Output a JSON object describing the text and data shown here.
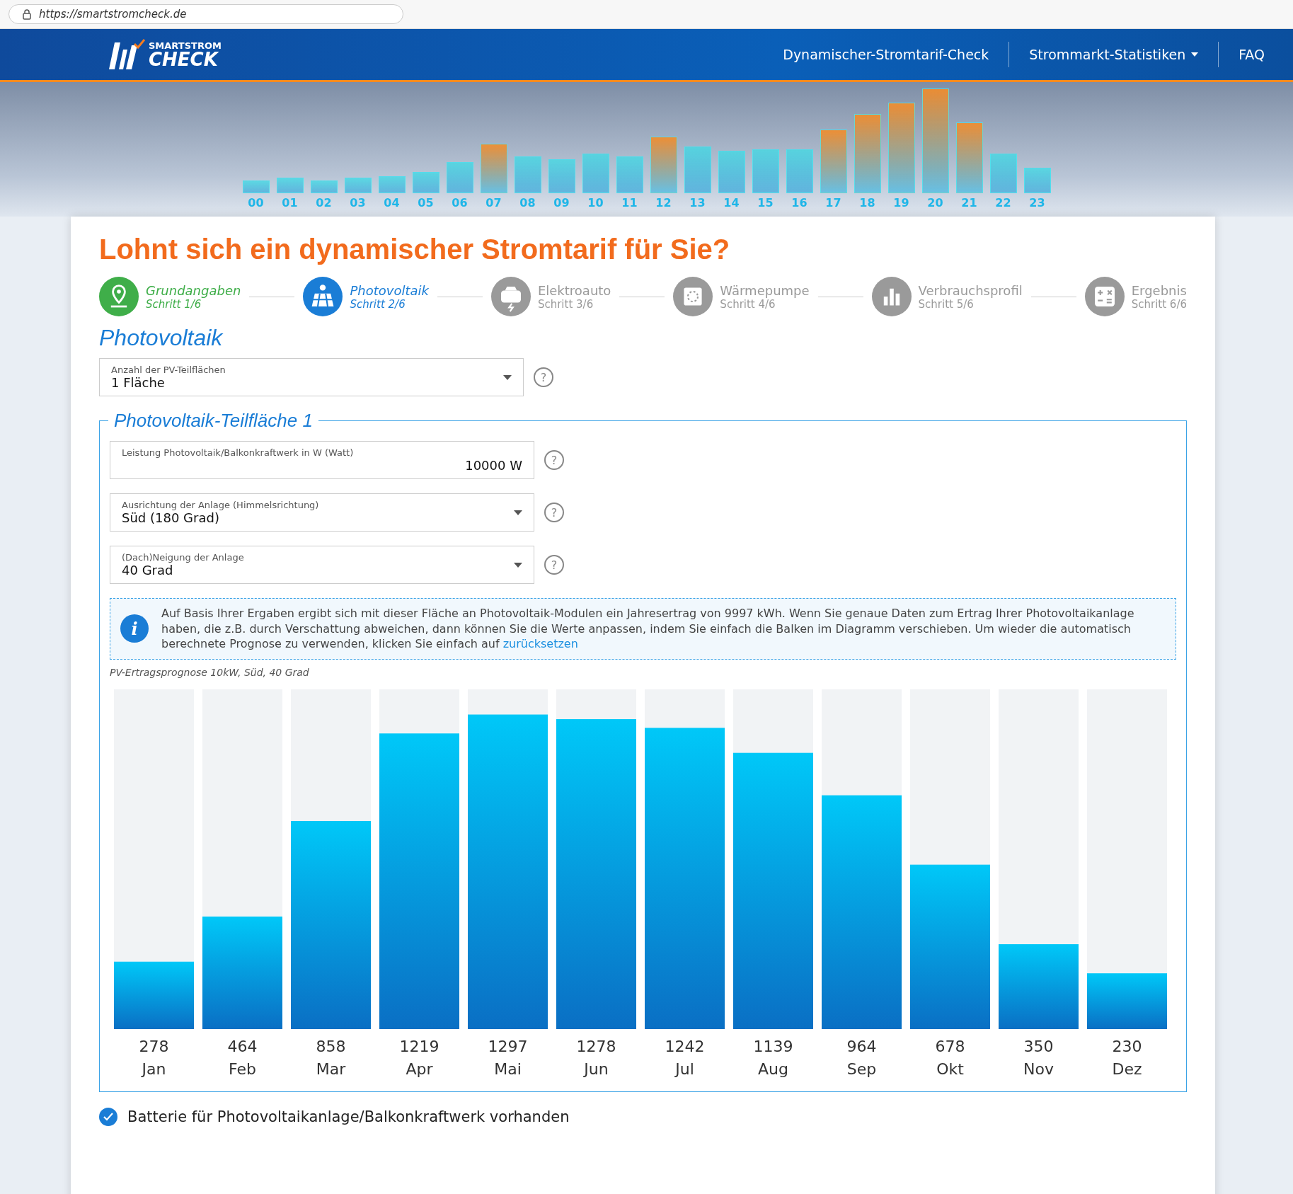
{
  "browser": {
    "url": "https://smartstromcheck.de"
  },
  "header": {
    "logo": {
      "top": "SMARTSTROM",
      "bottom": "CHECK"
    },
    "nav": [
      {
        "label": "Dynamischer-Stromtarif-Check",
        "has_menu": false
      },
      {
        "label": "Strommarkt-Statistiken",
        "has_menu": true
      },
      {
        "label": "FAQ",
        "has_menu": false
      }
    ],
    "hours": [
      "00",
      "01",
      "02",
      "03",
      "04",
      "05",
      "06",
      "07",
      "08",
      "09",
      "10",
      "11",
      "12",
      "13",
      "14",
      "15",
      "16",
      "17",
      "18",
      "19",
      "20",
      "21",
      "22",
      "23"
    ]
  },
  "page": {
    "title": "Lohnt sich ein dynamischer Stromtarif für Sie?",
    "steps": [
      {
        "title": "Grundangaben",
        "subtitle": "Schritt 1/6",
        "completed": true,
        "selected": false
      },
      {
        "title": "Photovoltaik",
        "subtitle": "Schritt 2/6",
        "completed": false,
        "selected": true
      },
      {
        "title": "Elektroauto",
        "subtitle": "Schritt 3/6",
        "completed": false,
        "selected": false
      },
      {
        "title": "Wärmepumpe",
        "subtitle": "Schritt 4/6",
        "completed": false,
        "selected": false
      },
      {
        "title": "Verbrauchsprofil",
        "subtitle": "Schritt 5/6",
        "completed": false,
        "selected": false
      },
      {
        "title": "Ergebnis",
        "subtitle": "Schritt 6/6",
        "completed": false,
        "selected": false
      }
    ],
    "section_title": "Photovoltaik",
    "count_field": {
      "label": "Anzahl der PV-Teilflächen",
      "value": "1 Fläche",
      "kind": "select",
      "help": "?"
    },
    "surface": {
      "legend": "Photovoltaik-Teilfläche 1",
      "fields": [
        {
          "label": "Leistung Photovoltaik/Balkonkraftwerk in W (Watt)",
          "value": "10000 W",
          "kind": "number",
          "help": "?"
        },
        {
          "label": "Ausrichtung der Anlage (Himmelsrichtung)",
          "value": "Süd (180 Grad)",
          "kind": "select",
          "help": "?"
        },
        {
          "label": "(Dach)Neigung der Anlage",
          "value": "40 Grad",
          "kind": "select",
          "help": "?"
        }
      ],
      "info": {
        "icon": "i",
        "text": "Auf Basis Ihrer Ergaben ergibt sich mit dieser Fläche an Photovoltaik-Modulen ein Jahresertrag von 9997 kWh. Wenn Sie genaue Daten zum Ertrag Ihrer Photovoltaikanlage haben, die z.B. durch Verschattung abweichen, dann können Sie die Werte anpassen, indem Sie einfach die Balken im Diagramm verschieben. Um wieder die automatisch berechnete Prognose zu verwenden, klicken Sie einfach auf",
        "link": "zurücksetzen"
      },
      "chart_data": {
        "type": "bar",
        "title": "PV-Ertragsprognose 10kW, Süd, 40 Grad",
        "categories": [
          "Jan",
          "Feb",
          "Mar",
          "Apr",
          "Mai",
          "Jun",
          "Jul",
          "Aug",
          "Sep",
          "Okt",
          "Nov",
          "Dez"
        ],
        "values": [
          278,
          464,
          858,
          1219,
          1297,
          1278,
          1242,
          1139,
          964,
          678,
          350,
          230
        ],
        "data_labels": true
      }
    },
    "battery": {
      "label": "Batterie für Photovoltaikanlage/Balkonkraftwerk vorhanden",
      "checked": true
    }
  }
}
